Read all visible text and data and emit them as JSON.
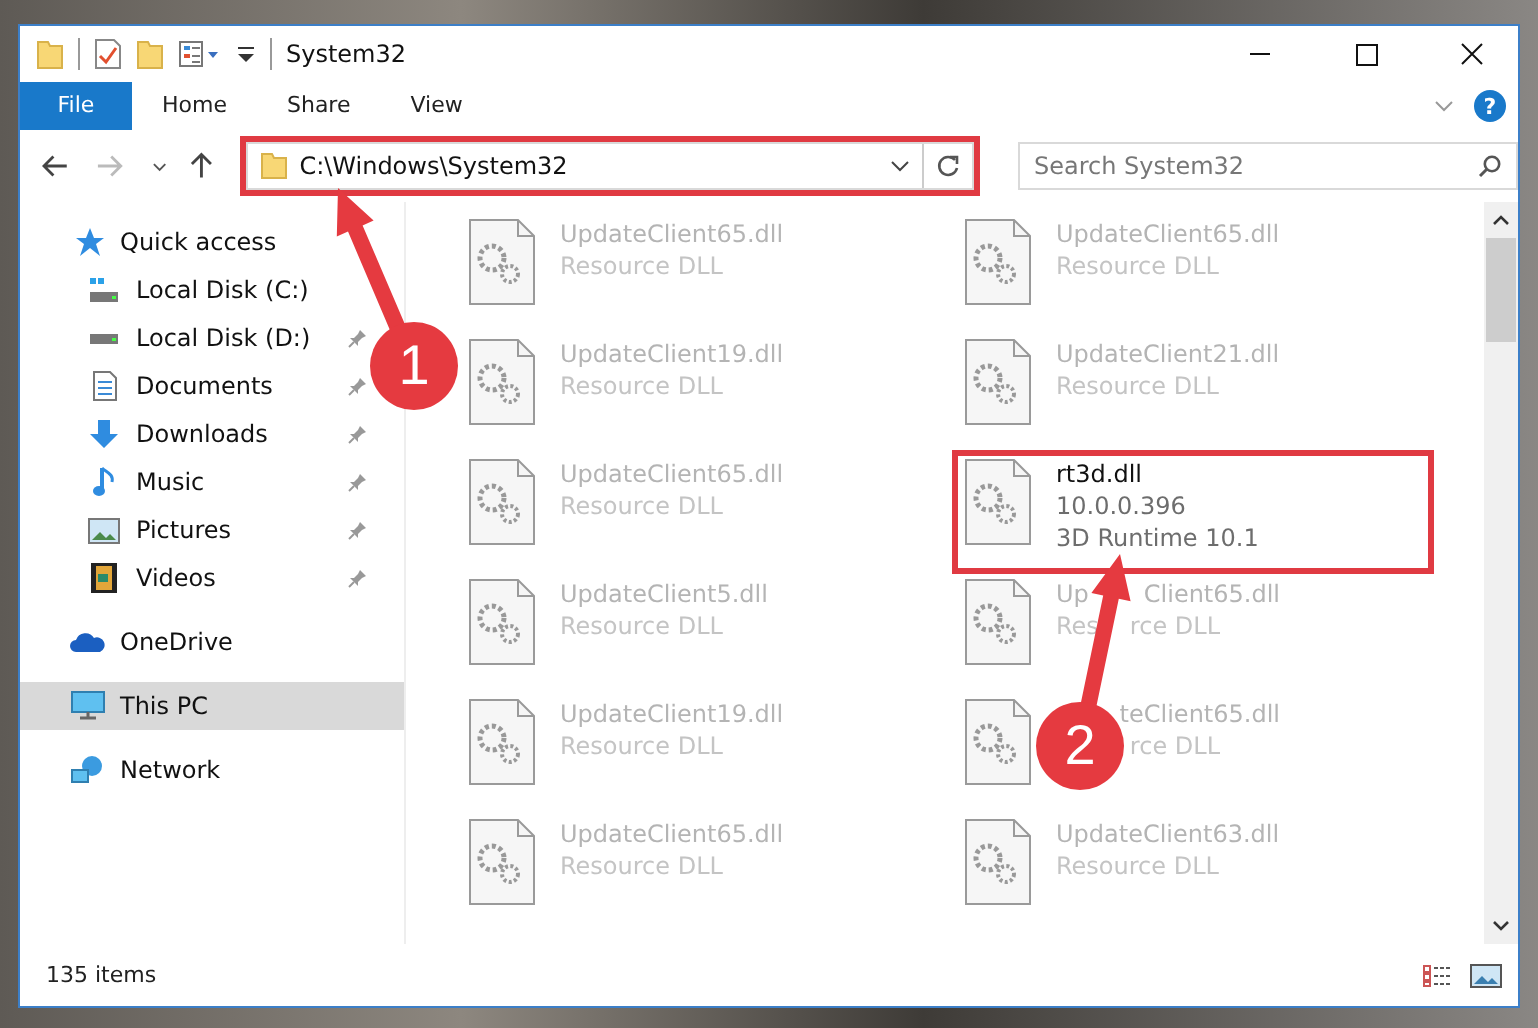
{
  "window": {
    "title": "System32"
  },
  "ribbon": {
    "tabs": [
      {
        "label": "File",
        "kind": "file"
      },
      {
        "label": "Home",
        "kind": "tab"
      },
      {
        "label": "Share",
        "kind": "tab"
      },
      {
        "label": "View",
        "kind": "tab"
      }
    ],
    "help": "?"
  },
  "address_bar": {
    "path": "C:\\Windows\\System32",
    "highlighted": true
  },
  "search": {
    "placeholder": "Search System32"
  },
  "sidebar": {
    "sections": [
      {
        "label": "Quick access",
        "kind": "quick",
        "selected": false,
        "children": [
          {
            "label": "Local Disk (C:)",
            "kind": "drive-c",
            "selected": false,
            "pinned": false
          },
          {
            "label": "Local Disk (D:)",
            "kind": "drive",
            "selected": false,
            "pinned": true
          },
          {
            "label": "Documents",
            "kind": "documents",
            "selected": false,
            "pinned": true
          },
          {
            "label": "Downloads",
            "kind": "downloads",
            "selected": false,
            "pinned": true
          },
          {
            "label": "Music",
            "kind": "music",
            "selected": false,
            "pinned": true
          },
          {
            "label": "Pictures",
            "kind": "pictures",
            "selected": false,
            "pinned": true
          },
          {
            "label": "Videos",
            "kind": "videos",
            "selected": false,
            "pinned": true
          }
        ]
      },
      {
        "label": "OneDrive",
        "kind": "cloud",
        "selected": false
      },
      {
        "label": "This PC",
        "kind": "pc",
        "selected": true
      },
      {
        "label": "Network",
        "kind": "network",
        "selected": false
      }
    ]
  },
  "files": [
    {
      "name": [
        "UpdateClient65.dll"
      ],
      "details": [
        [
          "Resource DLL"
        ]
      ],
      "blurred": true,
      "highlighted": false,
      "covered": false
    },
    {
      "name": [
        "UpdateClient65.dll"
      ],
      "details": [
        [
          "Resource DLL"
        ]
      ],
      "blurred": true,
      "highlighted": false,
      "covered": false
    },
    {
      "name": [
        "UpdateClient19.dll"
      ],
      "details": [
        [
          "Resource DLL"
        ]
      ],
      "blurred": true,
      "highlighted": false,
      "covered": false
    },
    {
      "name": [
        "UpdateClient21.dll"
      ],
      "details": [
        [
          "Resource DLL"
        ]
      ],
      "blurred": true,
      "highlighted": false,
      "covered": false
    },
    {
      "name": [
        "UpdateClient65.dll"
      ],
      "details": [
        [
          "Resource DLL"
        ]
      ],
      "blurred": true,
      "highlighted": false,
      "covered": false
    },
    {
      "name": [
        "rt3d.dll"
      ],
      "details": [
        [
          "10.0.0.396"
        ],
        [
          "3D Runtime 10.1"
        ]
      ],
      "blurred": false,
      "highlighted": true,
      "covered": false
    },
    {
      "name": [
        "UpdateClient5.dll"
      ],
      "details": [
        [
          "Resource DLL"
        ]
      ],
      "blurred": true,
      "highlighted": false,
      "covered": false
    },
    {
      "name": [
        "Up",
        "Client65.dll"
      ],
      "details": [
        [
          "Res",
          "rce DLL"
        ]
      ],
      "blurred": true,
      "highlighted": false,
      "covered": true
    },
    {
      "name": [
        "UpdateClient19.dll"
      ],
      "details": [
        [
          "Resource DLL"
        ]
      ],
      "blurred": true,
      "highlighted": false,
      "covered": false
    },
    {
      "name": [
        "teClient65.dll"
      ],
      "details": [
        [
          "rce DLL"
        ]
      ],
      "blurred": true,
      "highlighted": false,
      "covered": true
    },
    {
      "name": [
        "UpdateClient65.dll"
      ],
      "details": [
        [
          "Resource DLL"
        ]
      ],
      "blurred": true,
      "highlighted": false,
      "covered": false
    },
    {
      "name": [
        "UpdateClient63.dll"
      ],
      "details": [
        [
          "Resource DLL"
        ]
      ],
      "blurred": true,
      "highlighted": false,
      "covered": false
    }
  ],
  "status_bar": {
    "count": "135 items"
  },
  "annotations": [
    {
      "label": "1"
    },
    {
      "label": "2"
    }
  ]
}
